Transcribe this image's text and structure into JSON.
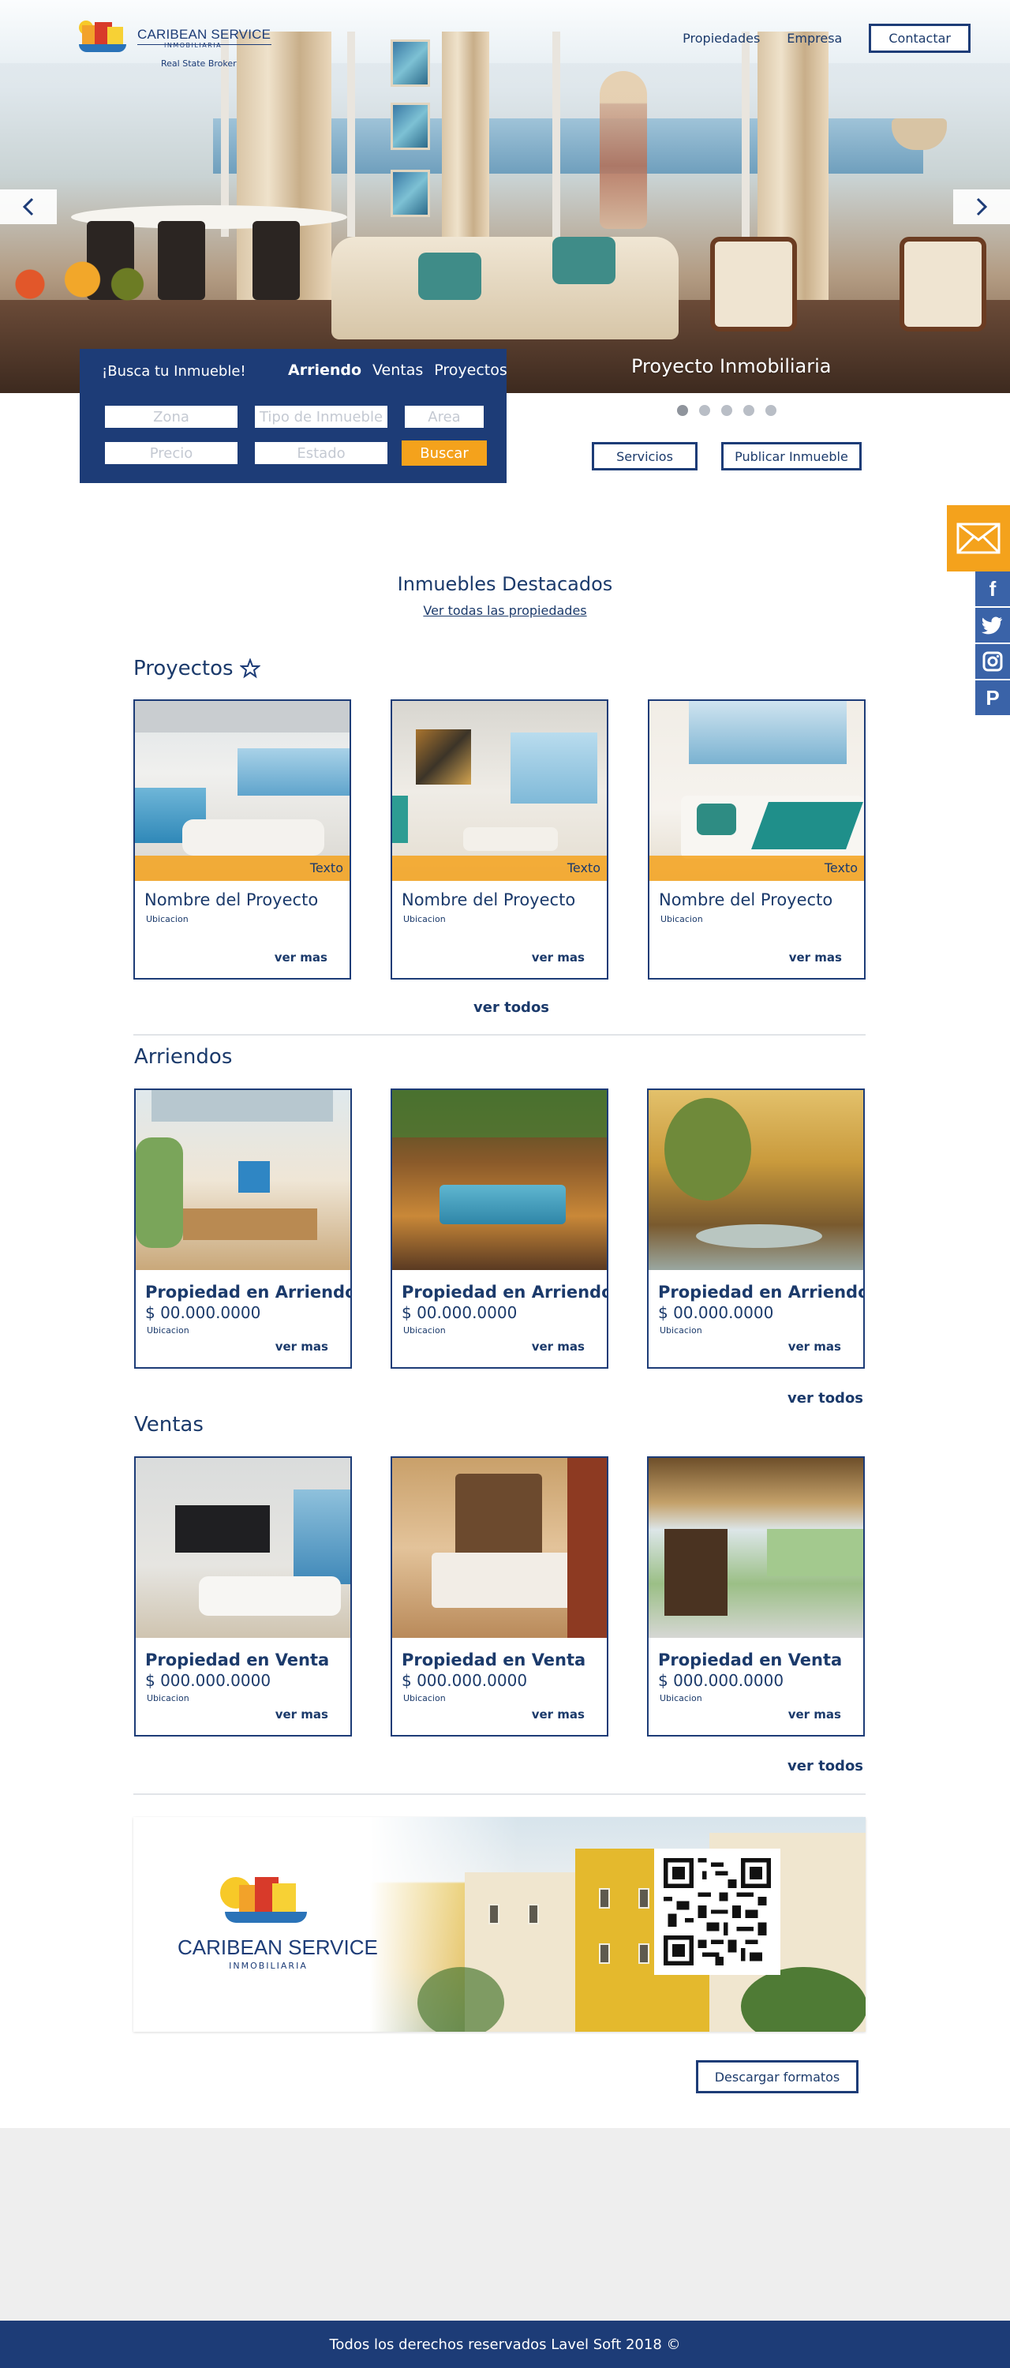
{
  "brand": {
    "name": "CARIBEAN SERVICE",
    "subtitle": "INMOBILIARIA",
    "tagline": "Real State Broker"
  },
  "nav": {
    "items": [
      "Propiedades",
      "Empresa"
    ],
    "contact": "Contactar"
  },
  "hero": {
    "caption": "Proyecto Inmobiliaria",
    "slides": 5,
    "active_slide": 1
  },
  "search": {
    "title": "¡Busca tu Inmueble!",
    "tabs": [
      "Arriendo",
      "Ventas",
      "Proyectos"
    ],
    "active_tab": "Arriendo",
    "fields": {
      "zona": "Zona",
      "tipo": "Tipo de Inmueble",
      "area": "Area",
      "precio": "Precio",
      "estado": "Estado"
    },
    "button": "Buscar"
  },
  "actions": {
    "servicios": "Servicios",
    "publicar": "Publicar Inmueble"
  },
  "featured": {
    "title": "Inmuebles Destacados",
    "link": "Ver todas las propiedades"
  },
  "proyectos": {
    "heading": "Proyectos",
    "cards": [
      {
        "badge": "Texto",
        "name": "Nombre del Proyecto",
        "location": "Ubicacion",
        "more": "ver mas"
      },
      {
        "badge": "Texto",
        "name": "Nombre del Proyecto",
        "location": "Ubicacion",
        "more": "ver mas"
      },
      {
        "badge": "Texto",
        "name": "Nombre del Proyecto",
        "location": "Ubicacion",
        "more": "ver mas"
      }
    ],
    "ver_todos": "ver todos"
  },
  "arriendos": {
    "heading": "Arriendos",
    "cards": [
      {
        "title": "Propiedad en Arriendo",
        "price": "$ 00.000.0000",
        "location": "Ubicacion",
        "more": "ver mas"
      },
      {
        "title": "Propiedad en Arriendo",
        "price": "$ 00.000.0000",
        "location": "Ubicacion",
        "more": "ver mas"
      },
      {
        "title": "Propiedad en Arriendo",
        "price": "$ 00.000.0000",
        "location": "Ubicacion",
        "more": "ver mas"
      }
    ],
    "ver_todos": "ver todos"
  },
  "ventas": {
    "heading": "Ventas",
    "cards": [
      {
        "title": "Propiedad en Venta",
        "price": "$ 000.000.0000",
        "location": "Ubicacion",
        "more": "ver mas"
      },
      {
        "title": "Propiedad en Venta",
        "price": "$ 000.000.0000",
        "location": "Ubicacion",
        "more": "ver mas"
      },
      {
        "title": "Propiedad en Venta",
        "price": "$ 000.000.0000",
        "location": "Ubicacion",
        "more": "ver mas"
      }
    ],
    "ver_todos": "ver todos"
  },
  "banner": {
    "name": "CARIBEAN SERVICE",
    "subtitle": "INMOBILIARIA"
  },
  "download": "Descargar formatos",
  "footer": "Todos los derechos reservados Lavel Soft 2018 ©",
  "colors": {
    "navy": "#1d3c77",
    "orange": "#f4a21c",
    "social_blue": "#3a63a8"
  },
  "icons": [
    "mail-icon",
    "facebook-icon",
    "twitter-icon",
    "instagram-icon",
    "pinterest-icon",
    "star-icon",
    "chevron-left-icon",
    "chevron-right-icon"
  ]
}
